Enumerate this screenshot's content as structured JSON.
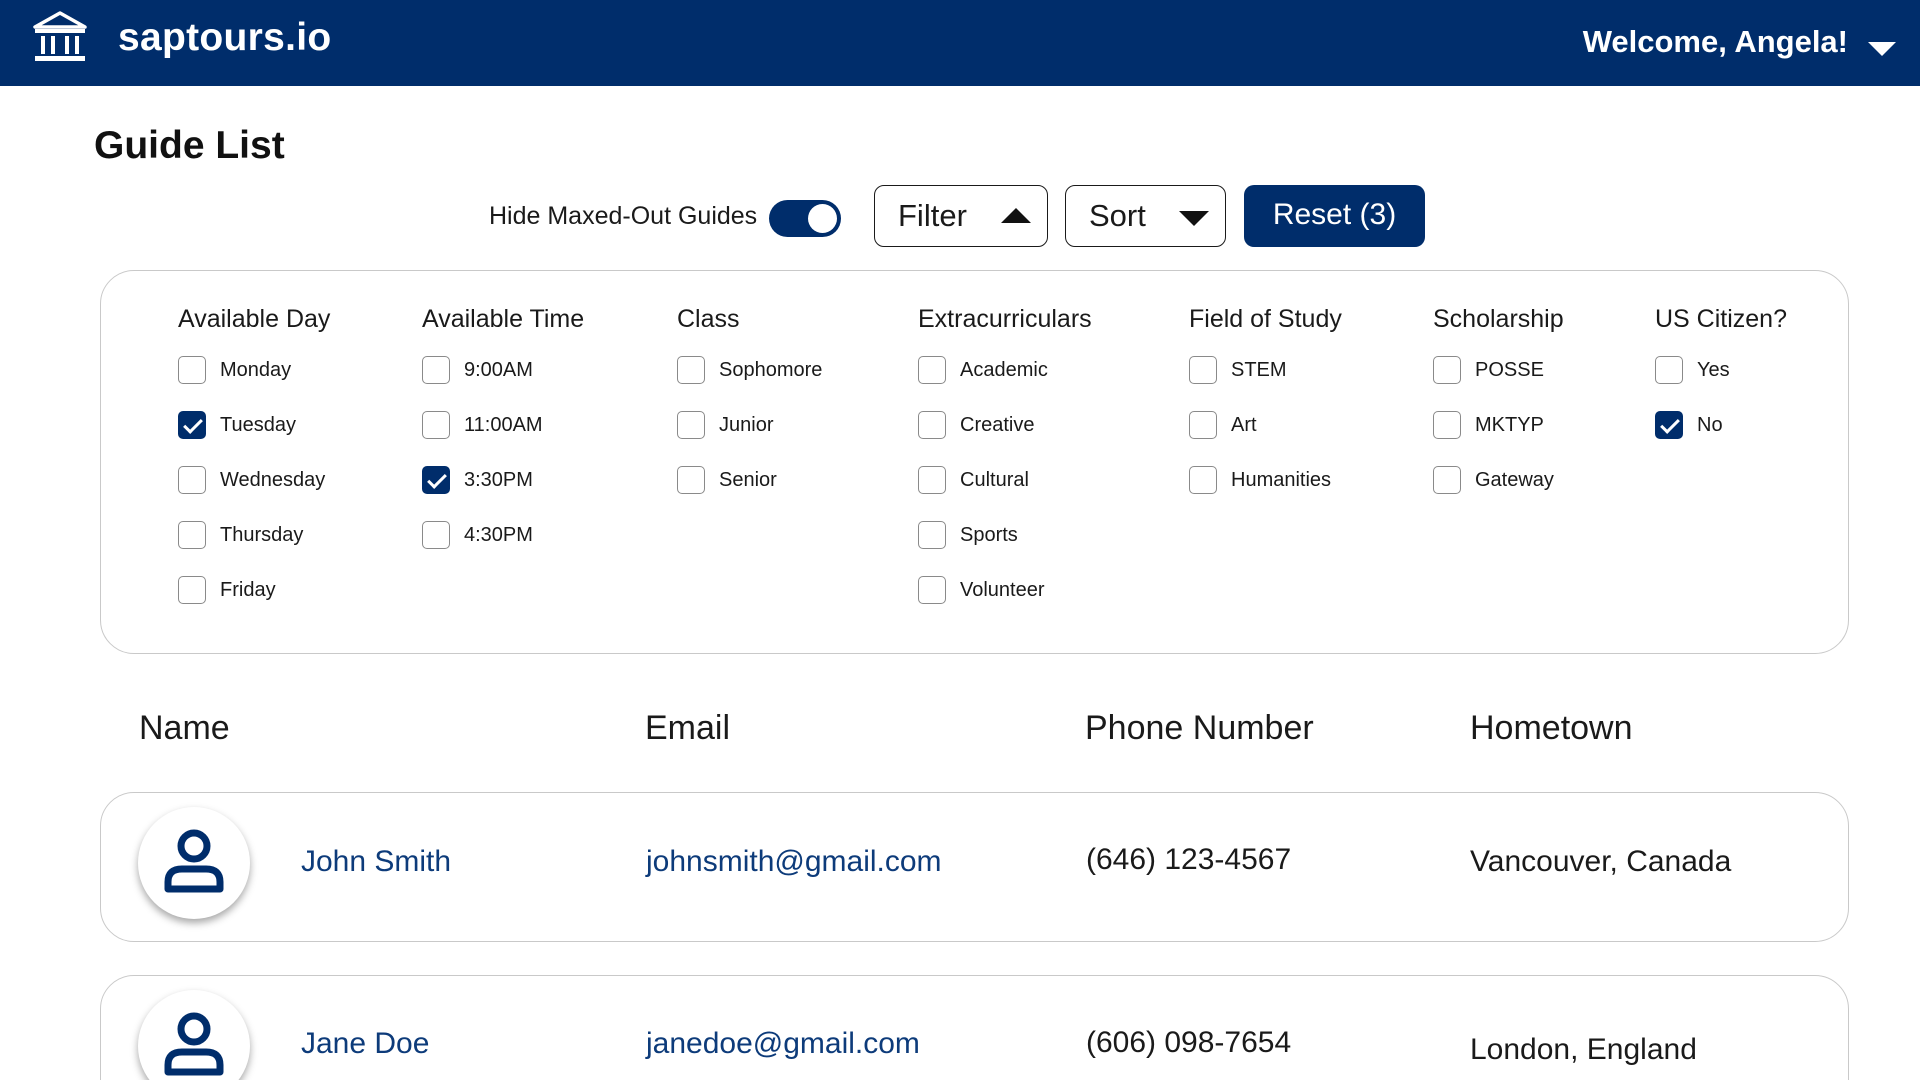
{
  "app": {
    "brand": "saptours.io",
    "welcome": "Welcome, Angela!"
  },
  "page": {
    "title": "Guide List"
  },
  "controls": {
    "hide_maxed_label": "Hide Maxed-Out Guides",
    "hide_maxed_on": true,
    "filter_label": "Filter",
    "sort_label": "Sort",
    "reset_label": "Reset (3)"
  },
  "filters": [
    {
      "title": "Available Day",
      "options": [
        {
          "label": "Monday",
          "checked": false
        },
        {
          "label": "Tuesday",
          "checked": true
        },
        {
          "label": "Wednesday",
          "checked": false
        },
        {
          "label": "Thursday",
          "checked": false
        },
        {
          "label": "Friday",
          "checked": false
        }
      ]
    },
    {
      "title": "Available Time",
      "options": [
        {
          "label": "9:00AM",
          "checked": false
        },
        {
          "label": "11:00AM",
          "checked": false
        },
        {
          "label": "3:30PM",
          "checked": true
        },
        {
          "label": "4:30PM",
          "checked": false
        }
      ]
    },
    {
      "title": "Class",
      "options": [
        {
          "label": "Sophomore",
          "checked": false
        },
        {
          "label": "Junior",
          "checked": false
        },
        {
          "label": "Senior",
          "checked": false
        }
      ]
    },
    {
      "title": "Extracurriculars",
      "options": [
        {
          "label": "Academic",
          "checked": false
        },
        {
          "label": "Creative",
          "checked": false
        },
        {
          "label": "Cultural",
          "checked": false
        },
        {
          "label": "Sports",
          "checked": false
        },
        {
          "label": "Volunteer",
          "checked": false
        }
      ]
    },
    {
      "title": "Field of Study",
      "options": [
        {
          "label": "STEM",
          "checked": false
        },
        {
          "label": "Art",
          "checked": false
        },
        {
          "label": "Humanities",
          "checked": false
        }
      ]
    },
    {
      "title": "Scholarship",
      "options": [
        {
          "label": "POSSE",
          "checked": false
        },
        {
          "label": "MKTYP",
          "checked": false
        },
        {
          "label": "Gateway",
          "checked": false
        }
      ]
    },
    {
      "title": "US Citizen?",
      "options": [
        {
          "label": "Yes",
          "checked": false
        },
        {
          "label": "No",
          "checked": true
        }
      ]
    }
  ],
  "table": {
    "headers": [
      "Name",
      "Email",
      "Phone Number",
      "Hometown"
    ],
    "rows": [
      {
        "name": "John Smith",
        "email": "johnsmith@gmail.com",
        "phone": "(646) 123-4567",
        "hometown": "Vancouver, Canada"
      },
      {
        "name": "Jane Doe",
        "email": "janedoe@gmail.com",
        "phone": "(606) 098-7654",
        "hometown": "London, England"
      }
    ]
  },
  "colors": {
    "brand_navy": "#002d6b",
    "link": "#0d3b7a",
    "border": "#c9c9c9"
  },
  "icons": [
    "museum-icon",
    "chevron-down-icon",
    "caret-up-icon",
    "user-icon"
  ]
}
